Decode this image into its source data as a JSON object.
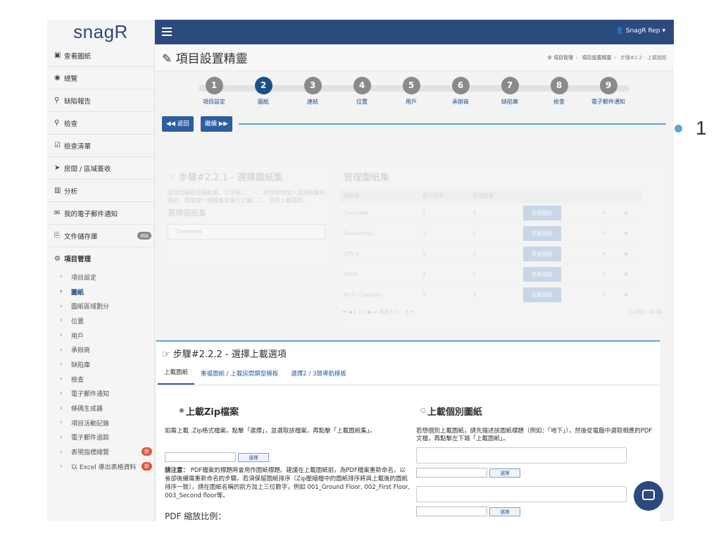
{
  "app": {
    "logo": "snagR"
  },
  "sidebar": {
    "items": [
      {
        "icon": "image-icon",
        "glyph": "▣",
        "label": "查看圖紙"
      },
      {
        "icon": "dashboard-icon",
        "glyph": "◉",
        "label": "總覽"
      },
      {
        "icon": "pin-icon",
        "glyph": "⚲",
        "label": "缺陷報告"
      },
      {
        "icon": "search-icon",
        "glyph": "⚲",
        "label": "檢查"
      },
      {
        "icon": "checklist-icon",
        "glyph": "☑",
        "label": "檢查清單"
      },
      {
        "icon": "send-icon",
        "glyph": "➤",
        "label": "房間 / 區域簽收"
      },
      {
        "icon": "chart-icon",
        "glyph": "▥",
        "label": "分析"
      },
      {
        "icon": "mail-icon",
        "glyph": "✉",
        "label": "我的電子郵件通知"
      },
      {
        "icon": "storage-icon",
        "glyph": "⎘",
        "label": "文件儲存庫",
        "badge": "測試"
      }
    ],
    "section": {
      "icon": "gears-icon",
      "glyph": "⚙",
      "label": "項目管理"
    },
    "sub_items": [
      {
        "label": "項目設定"
      },
      {
        "label": "圖紙",
        "active": true
      },
      {
        "label": "圖紙區域劃分"
      },
      {
        "label": "位置"
      },
      {
        "label": "用戶"
      },
      {
        "label": "承辦商"
      },
      {
        "label": "缺陷庫"
      },
      {
        "label": "檢查"
      },
      {
        "label": "電子郵件通知"
      },
      {
        "label": "條碼生成器"
      },
      {
        "label": "項目活動記錄"
      },
      {
        "label": "電子郵件追踪"
      },
      {
        "label": "表現指標總覽",
        "badge": "新"
      },
      {
        "label": "以 Excel 導出表格資料",
        "badge": "新"
      }
    ]
  },
  "topbar": {
    "user": "SnagR Rep ▾"
  },
  "header": {
    "title": "項目設置精靈",
    "breadcrumb": [
      "項目管理",
      "項目設置精靈",
      "步驟#2.2 - 上載圖紙"
    ]
  },
  "wizard": {
    "steps": [
      {
        "num": "1",
        "label": "項目設定"
      },
      {
        "num": "2",
        "label": "圖紙",
        "current": true
      },
      {
        "num": "3",
        "label": "連結"
      },
      {
        "num": "4",
        "label": "位置"
      },
      {
        "num": "5",
        "label": "用戶"
      },
      {
        "num": "6",
        "label": "承辦商"
      },
      {
        "num": "7",
        "label": "缺陷庫"
      },
      {
        "num": "8",
        "label": "檢查"
      },
      {
        "num": "9",
        "label": "電子郵件通知"
      }
    ],
    "back": "◀◀ 返回",
    "next": "繼續 ▶▶"
  },
  "step221": {
    "title": "☞ 步驟#2.2.1 - 選擇圖紙集",
    "text": "請添加圖紙至圖紙集。方法有二：一、組合您想加入至圖紙集的圖紙，壓縮成一個檔案並進行上載；二、個別上載圖紙。",
    "subtitle": "選擇圖紙集",
    "select_value": "Overview"
  },
  "manage": {
    "title": "管理圖紙集",
    "headers": [
      "圖紙集",
      "數字排序",
      "圖紙數量"
    ],
    "rows": [
      {
        "name": "Overview",
        "order": "1",
        "count": "6"
      },
      {
        "name": "Residential",
        "order": "2",
        "count": "2"
      },
      {
        "name": "Office",
        "order": "3",
        "count": "2"
      },
      {
        "name": "Hotel",
        "order": "4",
        "count": "1"
      },
      {
        "name": "Multi-Complex",
        "order": "5",
        "count": "3"
      }
    ],
    "view_label": "查看圖紙",
    "pager": "⏮ ◀ 1 2 3 ▶ ⏭   頁面大小： 5 ▾",
    "summary": "11項目，共3頁"
  },
  "step222": {
    "title": "☞ 步驟#2.2.2 - 選擇上載選項",
    "tabs": [
      "上載圖紙",
      "重複圖紙 / 上載房間類型模板",
      "選擇2 / 3層導航模板"
    ],
    "zip": {
      "heading": "上載Zip檔案",
      "help": "如需上載 .Zip格式檔案，點擊「選擇」，並選取該檔案，再點擊「上載圖紙集」。",
      "choose": "選擇",
      "note_label": "請注意：",
      "note": "PDF檔案的標題將會用作圖紙標題。建議在上載圖紙前，為PDF檔案重新命名，以省卻後續需重新命名的步驟。若須保留圖紙排序（Zip壓縮檔中的圖紙排序將與上載後的圖紙排序一致），請在圖紙名稱的前方加上三位數字，例如 001_Ground Floor, 002_First Floor, 003_Second floor等。",
      "scale": "PDF 縮放比例："
    },
    "single": {
      "heading": "上載個別圖紙",
      "help": "若想個別上載圖紙，請先描述該圖紙標題（例如：「地下」），然後從電腦中選取相應的PDF文檔，再點擊左下端「上載圖紙」。",
      "choose": "選擇"
    }
  },
  "callout": {
    "number": "1"
  },
  "colors": {
    "brand": "#2b4a7e",
    "accent": "#5aa6d6",
    "badge": "#e5533d"
  }
}
